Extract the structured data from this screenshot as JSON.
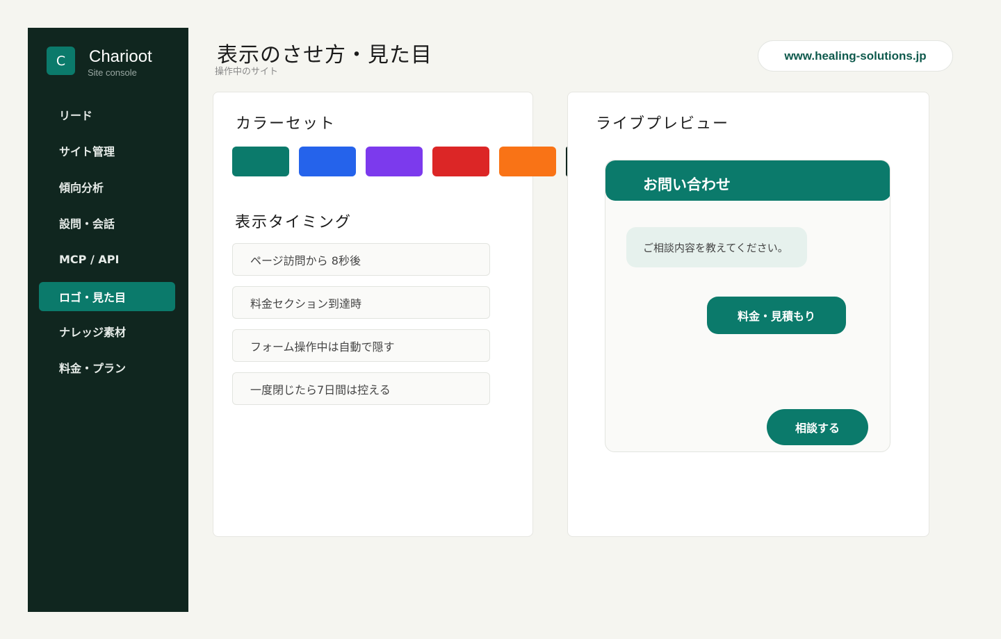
{
  "brand": {
    "logo_letter": "C",
    "name": "Charioot",
    "subtitle": "Site console"
  },
  "sidebar": {
    "items": [
      {
        "label": "リード"
      },
      {
        "label": "サイト管理"
      },
      {
        "label": "傾向分析"
      },
      {
        "label": "設問・会話"
      },
      {
        "label": "MCP / API"
      },
      {
        "label": "ロゴ・見た目",
        "active": true
      },
      {
        "label": "ナレッジ素材"
      },
      {
        "label": "料金・プラン"
      }
    ]
  },
  "header": {
    "title": "表示のさせ方・見た目",
    "subtitle": "操作中のサイト",
    "domain": "www.healing-solutions.jp"
  },
  "color_set": {
    "title": "カラーセット",
    "swatches": [
      {
        "color": "#0b7a6b"
      },
      {
        "color": "#2563eb"
      },
      {
        "color": "#7c3aed"
      },
      {
        "color": "#dc2626"
      },
      {
        "color": "#f97316"
      },
      {
        "color": "#10261f"
      }
    ]
  },
  "timing": {
    "title": "表示タイミング",
    "options": [
      {
        "label": "ページ訪問から 8秒後"
      },
      {
        "label": "料金セクション到達時"
      },
      {
        "label": "フォーム操作中は自動で隠す"
      },
      {
        "label": "一度閉じたら7日間は控える"
      }
    ]
  },
  "preview": {
    "title": "ライブプレビュー",
    "widget_title": "お問い合わせ",
    "bot_message": "ご相談内容を教えてください。",
    "choice_label": "料金・見積もり",
    "cta_label": "相談する"
  }
}
